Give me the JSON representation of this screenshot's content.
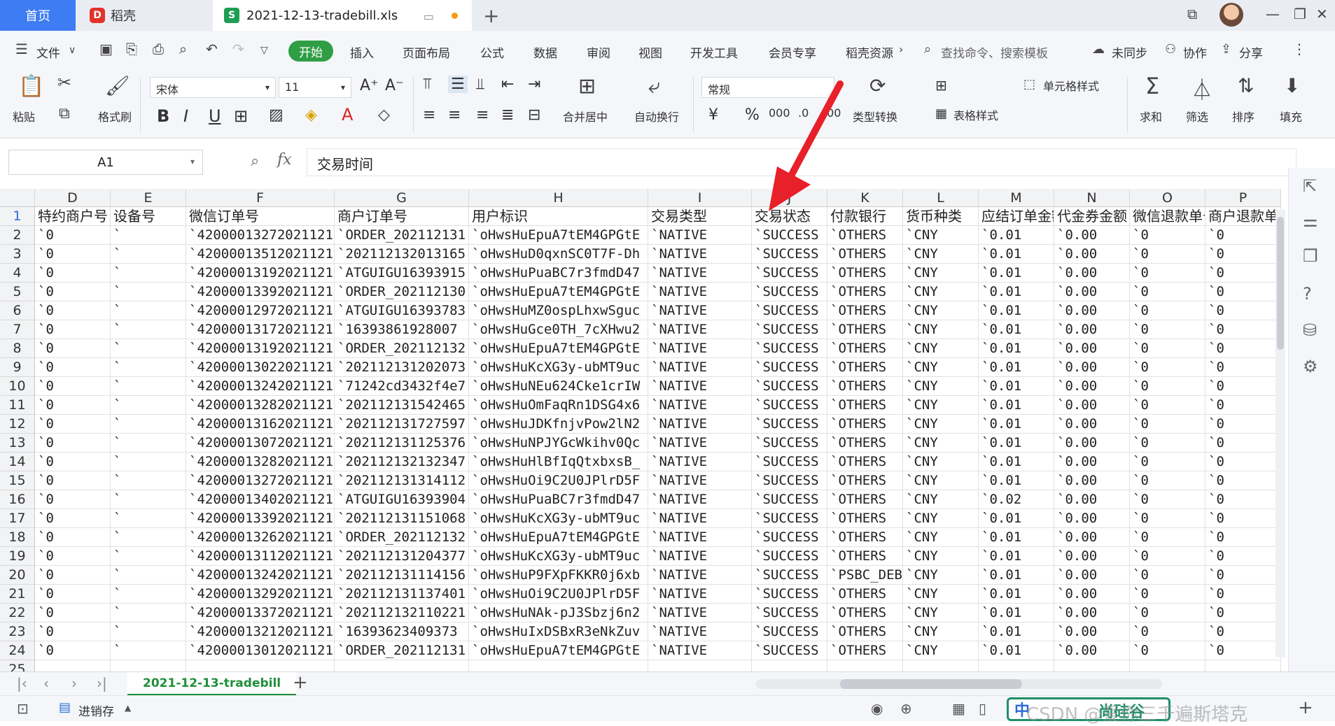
{
  "tabs": {
    "home": "首页",
    "daoke": "稻壳",
    "file": "2021-12-13-tradebill.xls"
  },
  "menu": {
    "file": "文件",
    "start": "开始",
    "items": [
      "插入",
      "页面布局",
      "公式",
      "数据",
      "审阅",
      "视图",
      "开发工具",
      "会员专享",
      "稻壳资源"
    ],
    "search": "查找命令、搜索模板",
    "sync": "未同步",
    "collab": "协作",
    "share": "分享"
  },
  "ribbon": {
    "paste": "粘贴",
    "format_brush": "格式刷",
    "font": "宋体",
    "size": "11",
    "merge": "合并居中",
    "wrap": "自动换行",
    "number_format": "常规",
    "type_convert": "类型转换",
    "cell_style": "单元格样式",
    "table_style": "表格样式",
    "sum": "求和",
    "filter": "筛选",
    "sort": "排序",
    "fill": "填充"
  },
  "formula_bar": {
    "cell_ref": "A1",
    "fx": "fx",
    "content": "交易时间"
  },
  "grid": {
    "columns": [
      "D",
      "E",
      "F",
      "G",
      "H",
      "I",
      "J",
      "K",
      "L",
      "M",
      "N",
      "O",
      "P"
    ],
    "header_row": [
      "特约商户号",
      "设备号",
      "微信订单号",
      "商户订单号",
      "用户标识",
      "交易类型",
      "交易状态",
      "付款银行",
      "货币种类",
      "应结订单金额",
      "代金券金额",
      "微信退款单号",
      "商户退款单号"
    ],
    "rows": [
      [
        "`0",
        "`",
        "`42000013272021121",
        "`ORDER_202112131",
        "`oHwsHuEpuA7tEM4GPGtE",
        "`NATIVE",
        "`SUCCESS",
        "`OTHERS",
        "`CNY",
        "`0.01",
        "`0.00",
        "`0",
        "`0"
      ],
      [
        "`0",
        "`",
        "`42000013512021121",
        "`202112132013165",
        "`oHwsHuD0qxnSC0T7F-Dh",
        "`NATIVE",
        "`SUCCESS",
        "`OTHERS",
        "`CNY",
        "`0.01",
        "`0.00",
        "`0",
        "`0"
      ],
      [
        "`0",
        "`",
        "`42000013192021121",
        "`ATGUIGU16393915",
        "`oHwsHuPuaBC7r3fmdD47",
        "`NATIVE",
        "`SUCCESS",
        "`OTHERS",
        "`CNY",
        "`0.01",
        "`0.00",
        "`0",
        "`0"
      ],
      [
        "`0",
        "`",
        "`42000013392021121",
        "`ORDER_202112130",
        "`oHwsHuEpuA7tEM4GPGtE",
        "`NATIVE",
        "`SUCCESS",
        "`OTHERS",
        "`CNY",
        "`0.01",
        "`0.00",
        "`0",
        "`0"
      ],
      [
        "`0",
        "`",
        "`42000012972021121",
        "`ATGUIGU16393783",
        "`oHwsHuMZ0ospLhxwSguc",
        "`NATIVE",
        "`SUCCESS",
        "`OTHERS",
        "`CNY",
        "`0.01",
        "`0.00",
        "`0",
        "`0"
      ],
      [
        "`0",
        "`",
        "`42000013172021121",
        "`16393861928007",
        "`oHwsHuGce0TH_7cXHwu2",
        "`NATIVE",
        "`SUCCESS",
        "`OTHERS",
        "`CNY",
        "`0.01",
        "`0.00",
        "`0",
        "`0"
      ],
      [
        "`0",
        "`",
        "`42000013192021121",
        "`ORDER_202112132",
        "`oHwsHuEpuA7tEM4GPGtE",
        "`NATIVE",
        "`SUCCESS",
        "`OTHERS",
        "`CNY",
        "`0.01",
        "`0.00",
        "`0",
        "`0"
      ],
      [
        "`0",
        "`",
        "`42000013022021121",
        "`202112131202073",
        "`oHwsHuKcXG3y-ubMT9uc",
        "`NATIVE",
        "`SUCCESS",
        "`OTHERS",
        "`CNY",
        "`0.01",
        "`0.00",
        "`0",
        "`0"
      ],
      [
        "`0",
        "`",
        "`42000013242021121",
        "`71242cd3432f4e7",
        "`oHwsHuNEu624Cke1crIW",
        "`NATIVE",
        "`SUCCESS",
        "`OTHERS",
        "`CNY",
        "`0.01",
        "`0.00",
        "`0",
        "`0"
      ],
      [
        "`0",
        "`",
        "`42000013282021121",
        "`202112131542465",
        "`oHwsHuOmFaqRn1DSG4x6",
        "`NATIVE",
        "`SUCCESS",
        "`OTHERS",
        "`CNY",
        "`0.01",
        "`0.00",
        "`0",
        "`0"
      ],
      [
        "`0",
        "`",
        "`42000013162021121",
        "`202112131727597",
        "`oHwsHuJDKfnjvPow2lN2",
        "`NATIVE",
        "`SUCCESS",
        "`OTHERS",
        "`CNY",
        "`0.01",
        "`0.00",
        "`0",
        "`0"
      ],
      [
        "`0",
        "`",
        "`42000013072021121",
        "`202112131125376",
        "`oHwsHuNPJYGcWkihv0Qc",
        "`NATIVE",
        "`SUCCESS",
        "`OTHERS",
        "`CNY",
        "`0.01",
        "`0.00",
        "`0",
        "`0"
      ],
      [
        "`0",
        "`",
        "`42000013282021121",
        "`202112132132347",
        "`oHwsHuHlBfIqQtxbxsB_",
        "`NATIVE",
        "`SUCCESS",
        "`OTHERS",
        "`CNY",
        "`0.01",
        "`0.00",
        "`0",
        "`0"
      ],
      [
        "`0",
        "`",
        "`42000013272021121",
        "`202112131314112",
        "`oHwsHuOi9C2U0JPlrD5F",
        "`NATIVE",
        "`SUCCESS",
        "`OTHERS",
        "`CNY",
        "`0.01",
        "`0.00",
        "`0",
        "`0"
      ],
      [
        "`0",
        "`",
        "`42000013402021121",
        "`ATGUIGU16393904",
        "`oHwsHuPuaBC7r3fmdD47",
        "`NATIVE",
        "`SUCCESS",
        "`OTHERS",
        "`CNY",
        "`0.02",
        "`0.00",
        "`0",
        "`0"
      ],
      [
        "`0",
        "`",
        "`42000013392021121",
        "`202112131151068",
        "`oHwsHuKcXG3y-ubMT9uc",
        "`NATIVE",
        "`SUCCESS",
        "`OTHERS",
        "`CNY",
        "`0.01",
        "`0.00",
        "`0",
        "`0"
      ],
      [
        "`0",
        "`",
        "`42000013262021121",
        "`ORDER_202112132",
        "`oHwsHuEpuA7tEM4GPGtE",
        "`NATIVE",
        "`SUCCESS",
        "`OTHERS",
        "`CNY",
        "`0.01",
        "`0.00",
        "`0",
        "`0"
      ],
      [
        "`0",
        "`",
        "`42000013112021121",
        "`202112131204377",
        "`oHwsHuKcXG3y-ubMT9uc",
        "`NATIVE",
        "`SUCCESS",
        "`OTHERS",
        "`CNY",
        "`0.01",
        "`0.00",
        "`0",
        "`0"
      ],
      [
        "`0",
        "`",
        "`42000013242021121",
        "`202112131114156",
        "`oHwsHuP9FXpFKKR0j6xb",
        "`NATIVE",
        "`SUCCESS",
        "`PSBC_DEB",
        "`CNY",
        "`0.01",
        "`0.00",
        "`0",
        "`0"
      ],
      [
        "`0",
        "`",
        "`42000013292021121",
        "`202112131137401",
        "`oHwsHuOi9C2U0JPlrD5F",
        "`NATIVE",
        "`SUCCESS",
        "`OTHERS",
        "`CNY",
        "`0.01",
        "`0.00",
        "`0",
        "`0"
      ],
      [
        "`0",
        "`",
        "`42000013372021121",
        "`202112132110221",
        "`oHwsHuNAk-pJ3Sbzj6n2",
        "`NATIVE",
        "`SUCCESS",
        "`OTHERS",
        "`CNY",
        "`0.01",
        "`0.00",
        "`0",
        "`0"
      ],
      [
        "`0",
        "`",
        "`42000013212021121",
        "`16393623409373",
        "`oHwsHuIxDSBxR3eNkZuv",
        "`NATIVE",
        "`SUCCESS",
        "`OTHERS",
        "`CNY",
        "`0.01",
        "`0.00",
        "`0",
        "`0"
      ],
      [
        "`0",
        "`",
        "`42000013012021121",
        "`ORDER_202112131",
        "`oHwsHuEpuA7tEM4GPGtE",
        "`NATIVE",
        "`SUCCESS",
        "`OTHERS",
        "`CNY",
        "`0.01",
        "`0.00",
        "`0",
        "`0"
      ]
    ],
    "row_numbers": [
      "1",
      "2",
      "3",
      "4",
      "5",
      "6",
      "7",
      "8",
      "9",
      "10",
      "11",
      "12",
      "13",
      "14",
      "15",
      "16",
      "17",
      "18",
      "19",
      "20",
      "21",
      "22",
      "23",
      "24",
      "25"
    ]
  },
  "sheet": {
    "name": "2021-12-13-tradebill",
    "status_label": "进销存"
  },
  "watermark": {
    "csdn": "CSDN @爱你三千遍斯塔克",
    "ime": "中",
    "badge": "尚硅谷"
  },
  "colors": {
    "accent_blue": "#3d7cf2",
    "start_green": "#2f9e44",
    "arrow_red": "#e8202a",
    "sheet_tab_green": "#1f8f3a"
  }
}
